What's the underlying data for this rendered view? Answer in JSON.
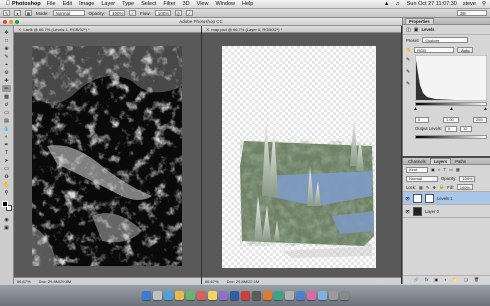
{
  "menubar": {
    "app": "Photoshop",
    "items": [
      "File",
      "Edit",
      "Image",
      "Layer",
      "Type",
      "Select",
      "Filter",
      "3D",
      "View",
      "Window",
      "Help"
    ],
    "clock": "Sun Oct 27  11:07:30",
    "user": "steve"
  },
  "options": {
    "mode_label": "Mode:",
    "mode_value": "Normal",
    "opacity_label": "Opacity:",
    "opacity_value": "100%",
    "flow_label": "Flow:",
    "flow_value": "100%",
    "workspace": "3D"
  },
  "window_title": "Adobe Photoshop CC",
  "docs": [
    {
      "tab": "Lavik @ 66.7% (Levels 1, RGB/32*) *",
      "zoom": "66.67%",
      "doc_size": "Doc: 29.8M/29.8M"
    },
    {
      "tab": "map.psd @ 66.7% (Layer 0, RGB/32*) *",
      "zoom": "66.67%",
      "doc_size": "Doc: 29.8M/22.1M"
    }
  ],
  "properties": {
    "tab": "Properties",
    "section": "Levels",
    "preset_label": "Preset:",
    "preset_value": "Custom",
    "channel_value": "RGB",
    "auto_label": "Auto",
    "input_values": [
      "0",
      "1.00",
      "255"
    ],
    "output_label": "Output Levels:",
    "output_values": [
      "0",
      "12"
    ]
  },
  "layers": {
    "tabs": [
      "Channels",
      "Layers",
      "Paths"
    ],
    "active_tab": "Layers",
    "kind_label": "Kind",
    "blend_value": "Normal",
    "opacity_label": "Opacity:",
    "opacity_value": "100%",
    "lock_label": "Lock:",
    "fill_label": "Fill:",
    "fill_value": "100%",
    "items": [
      {
        "name": "Levels 1",
        "selected": true
      },
      {
        "name": "Layer 0",
        "selected": false
      }
    ]
  },
  "colors": {
    "selection": "#a9c5e8",
    "panel_bg": "#d6d6d6",
    "workspace_bg": "#595959"
  }
}
